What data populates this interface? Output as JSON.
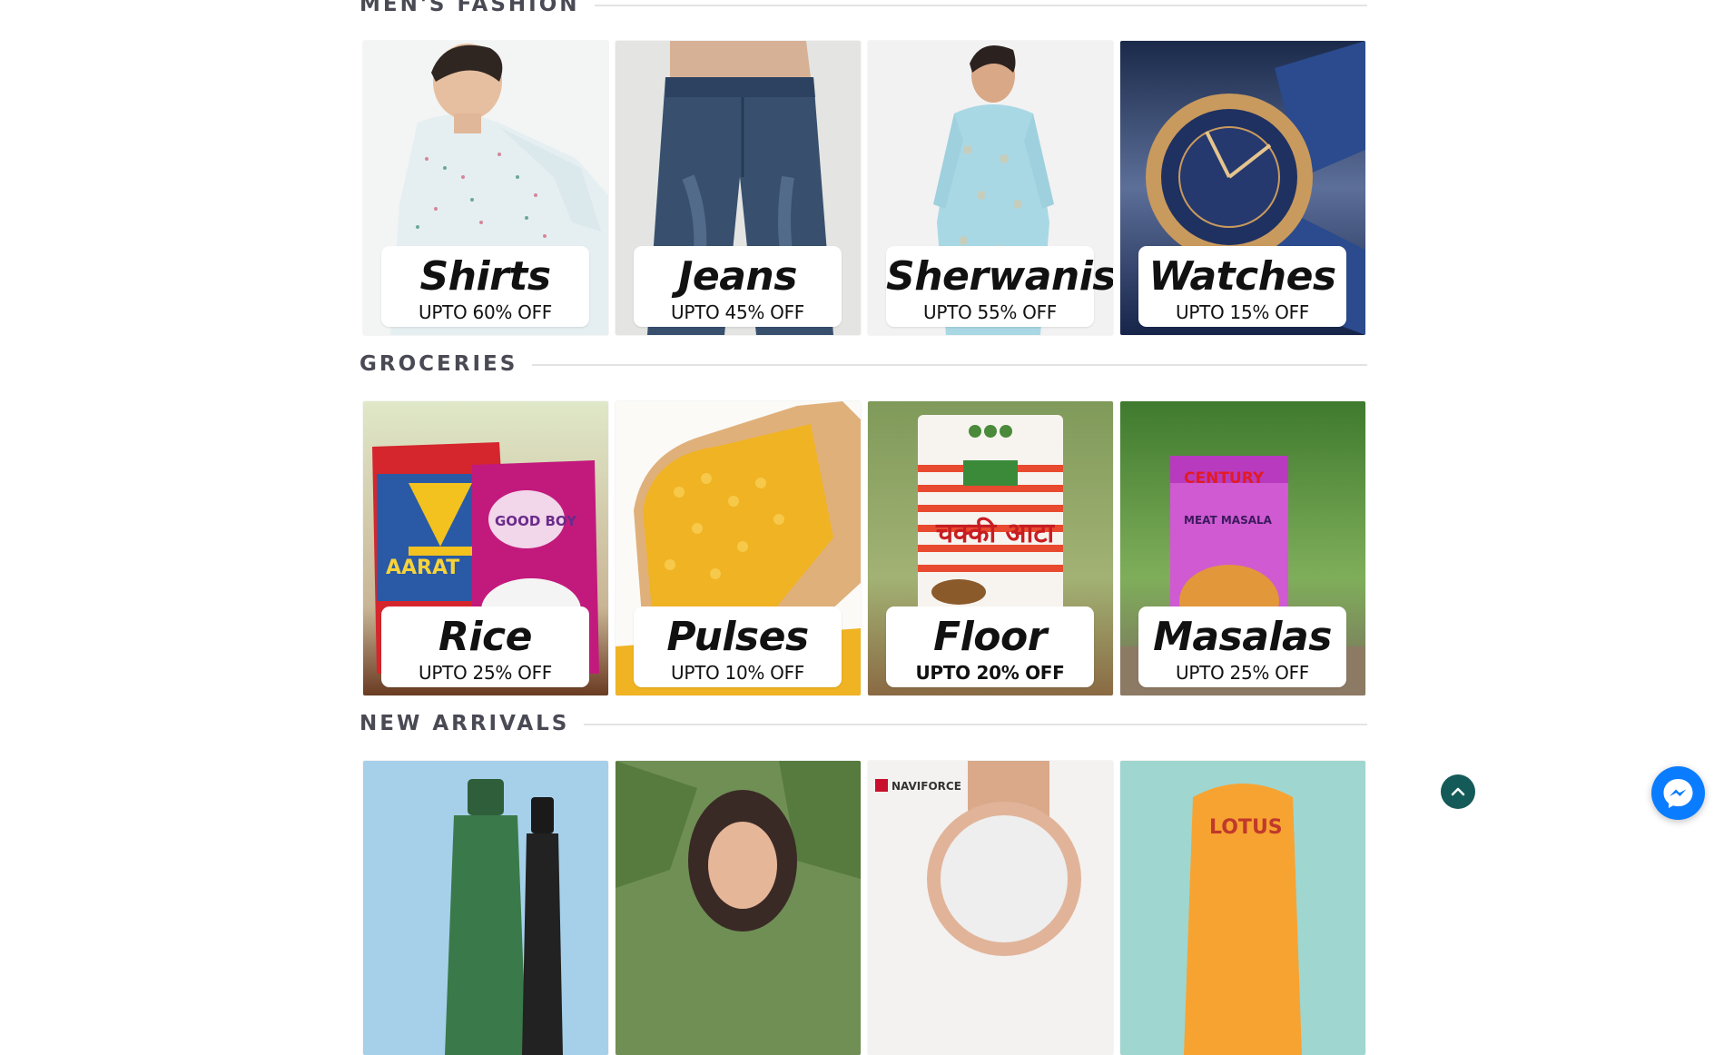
{
  "colors": {
    "section_title": "#4a4a55",
    "divider": "#e3e3e3",
    "badge_bg": "#ffffff",
    "badge_text": "#111111",
    "scroll_top_bg": "#145a58",
    "messenger_bg": "#0a7cff"
  },
  "sections": [
    {
      "title": "MEN'S FASHION",
      "cards": [
        {
          "name": "Shirts",
          "offer": "UPTO 60% OFF",
          "icon": "shirt-model-photo"
        },
        {
          "name": "Jeans",
          "offer": "UPTO 45% OFF",
          "icon": "jeans-model-photo"
        },
        {
          "name": "Sherwanis",
          "offer": "UPTO 55% OFF",
          "icon": "sherwani-model-photo"
        },
        {
          "name": "Watches",
          "offer": "UPTO 15% OFF",
          "icon": "watch-product-photo"
        }
      ]
    },
    {
      "title": "GROCERIES",
      "cards": [
        {
          "name": "Rice",
          "offer": "UPTO 25% OFF",
          "icon": "rice-bags-photo",
          "packs": [
            "AARAT",
            "GOOD BOY"
          ]
        },
        {
          "name": "Pulses",
          "offer": "UPTO 10% OFF",
          "icon": "lentils-scoop-photo"
        },
        {
          "name": "Floor",
          "offer": "UPTO 20% OFF",
          "icon": "atta-bag-photo",
          "packs": [
            "चक्की आटा"
          ]
        },
        {
          "name": "Masalas",
          "offer": "UPTO 25% OFF",
          "icon": "masala-box-photo",
          "packs": [
            "CENTURY",
            "MEAT MASALA"
          ]
        }
      ]
    },
    {
      "title": "NEW ARRIVALS",
      "cards": [
        {
          "icon": "hair-oil-bottles-photo"
        },
        {
          "icon": "woman-earrings-photo"
        },
        {
          "icon": "naviforce-watch-photo",
          "brand": "NAVIFORCE"
        },
        {
          "icon": "lotus-sunscreen-photo",
          "brand": "LOTUS"
        }
      ]
    }
  ],
  "floating": {
    "scroll_top_icon": "chevron-up-icon",
    "messenger_icon": "messenger-icon"
  }
}
